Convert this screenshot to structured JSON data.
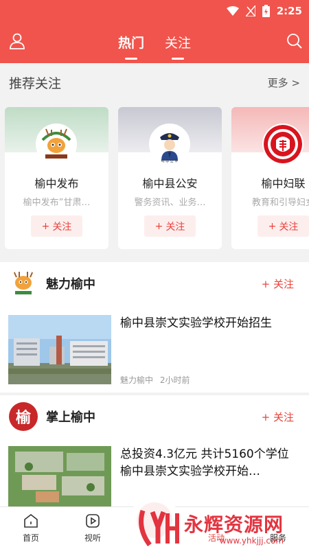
{
  "status": {
    "time": "2:25"
  },
  "header": {
    "tabs": [
      {
        "label": "热门",
        "active": true
      },
      {
        "label": "关注",
        "active": false
      }
    ],
    "accent": "#f0544c"
  },
  "recommend": {
    "title": "推荐关注",
    "more": "更多 >",
    "cards": [
      {
        "name": "榆中发布",
        "desc": "榆中发布”甘肃…",
        "follow": "关注",
        "top_color": "#cfe5d3"
      },
      {
        "name": "榆中县公安",
        "desc": "警务资讯、业务…",
        "follow": "关注",
        "top_color": "#d8d8e0"
      },
      {
        "name": "榆中妇联",
        "desc": "教育和引导妇女",
        "follow": "关注",
        "top_color": "#f7c8c8"
      }
    ]
  },
  "feeds": [
    {
      "source": "魅力榆中",
      "follow": "关注",
      "article_title": "榆中县崇文实验学校开始招生",
      "meta_source": "魅力榆中",
      "meta_time": "2小时前"
    },
    {
      "source": "掌上榆中",
      "logo_char": "榆",
      "follow": "关注",
      "article_title": "总投资4.3亿元 共计5160个学位 榆中县崇文实验学校开始…"
    }
  ],
  "bottom_nav": [
    {
      "label": "首页",
      "icon": "home-icon"
    },
    {
      "label": "视听",
      "icon": "play-icon"
    },
    {
      "label": "",
      "icon": "center-icon"
    },
    {
      "label": "活动",
      "icon": "activity-icon"
    },
    {
      "label": "服务",
      "icon": "service-icon"
    }
  ],
  "watermark": {
    "text": "永辉资源网",
    "url": "www.yhkjjj.com"
  }
}
